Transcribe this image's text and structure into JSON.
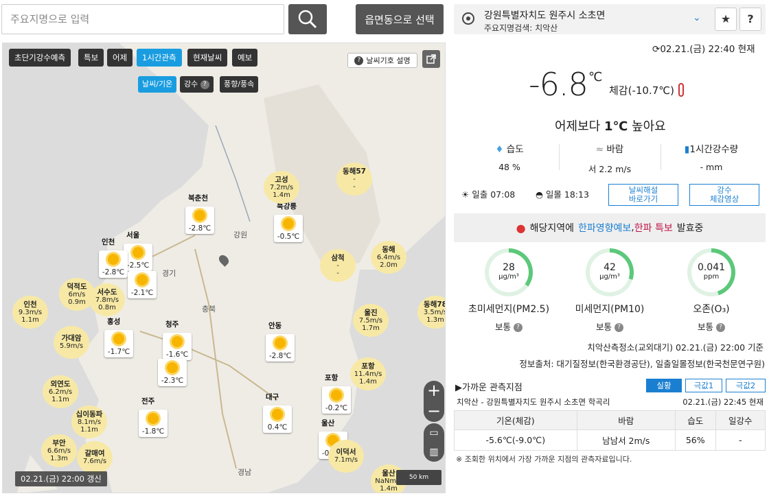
{
  "search": {
    "placeholder": "주요지명으로 입력",
    "region_button": "읍면동으로 선택"
  },
  "map": {
    "tabs": [
      "초단기강수예측",
      "특보",
      "어제",
      "1시간관측",
      "현재날씨",
      "예보"
    ],
    "active_tab": "1시간관측",
    "subtabs": [
      "날씨/기온",
      "강수",
      "풍향/풍속"
    ],
    "legend_button": "날씨기호 설명",
    "update_time": "02.21.(금) 22:00 갱신",
    "scale": "50 km",
    "region_labels": [
      "강원",
      "경기",
      "충북",
      "경남"
    ],
    "sun_stations": [
      {
        "name": "북춘천",
        "temp": "-2.8℃"
      },
      {
        "name": "북강릉",
        "temp": "-0.5℃"
      },
      {
        "name": "서울",
        "temp": "-2.5℃"
      },
      {
        "name": "인천",
        "temp": "-2.8℃"
      },
      {
        "name": "",
        "temp": "-2.1℃"
      },
      {
        "name": "홍성",
        "temp": "-1.7℃"
      },
      {
        "name": "청주",
        "temp": "-1.6℃"
      },
      {
        "name": "",
        "temp": "-2.3℃"
      },
      {
        "name": "안동",
        "temp": "-2.8℃"
      },
      {
        "name": "전주",
        "temp": "-1.8℃"
      },
      {
        "name": "대구",
        "temp": "0.4℃"
      },
      {
        "name": "포항",
        "temp": "-0.2℃"
      },
      {
        "name": "울산",
        "temp": "-0.3℃"
      }
    ],
    "wind_stations": [
      {
        "name": "고성",
        "speed": "7.2",
        "wave": "1.4"
      },
      {
        "name": "동해57",
        "speed": "-",
        "wave": "-"
      },
      {
        "name": "동해",
        "speed": "6.4",
        "wave": "2.0"
      },
      {
        "name": "삼척",
        "speed": "-",
        "wave": "-"
      },
      {
        "name": "인천",
        "speed": "9.3",
        "wave": "1.1"
      },
      {
        "name": "덕적도",
        "speed": "6",
        "wave": "0.9"
      },
      {
        "name": "서수도",
        "speed": "7.8",
        "wave": "0.8"
      },
      {
        "name": "가대암",
        "speed": "5.9",
        "wave": ""
      },
      {
        "name": "울진",
        "speed": "7.5",
        "wave": "1.7"
      },
      {
        "name": "동해78",
        "speed": "3.5",
        "wave": "1.3"
      },
      {
        "name": "포항",
        "speed": "11.4",
        "wave": "1.4"
      },
      {
        "name": "외연도",
        "speed": "6.2",
        "wave": "1.1"
      },
      {
        "name": "십이동파",
        "speed": "8.1",
        "wave": "1.1"
      },
      {
        "name": "부안",
        "speed": "6.6",
        "wave": "1.3"
      },
      {
        "name": "갈매여",
        "speed": "7.6",
        "wave": ""
      },
      {
        "name": "이덕서",
        "speed": "7.1",
        "wave": ""
      },
      {
        "name": "울산",
        "speed": "NaN",
        "wave": "1.4"
      }
    ]
  },
  "location": {
    "name": "강원특별자치도 원주시 소초면",
    "search": "주요지명검색: 치악산"
  },
  "obs_time": "02.21.(금) 22:40 현재",
  "current": {
    "temp": "-6.8",
    "unit": "℃",
    "feels": "체감(-10.7℃)",
    "compare_prefix": "어제보다",
    "compare_value": "1℃",
    "compare_suffix": "높아요"
  },
  "stats": [
    {
      "label": "습도",
      "value": "48 %"
    },
    {
      "label": "바람",
      "value": "서 2.2 m/s"
    },
    {
      "label": "1시간강수량",
      "value": "- mm"
    }
  ],
  "sun": {
    "sunrise_label": "일출",
    "sunrise": "07:08",
    "sunset_label": "일몰",
    "sunset": "18:13"
  },
  "links": {
    "weather_explain": "날씨해설\n바로가기",
    "precip_video": "강수\n체감영상"
  },
  "warning": {
    "prefix": "해당지역에",
    "impact": "한파영향예보",
    "sep": ",",
    "alert": "한파 특보",
    "suffix": "발효중"
  },
  "air": [
    {
      "value": "28",
      "unit": "μg/m³",
      "name": "초미세먼지(PM2.5)",
      "grade": "보통",
      "fraction": 0.35
    },
    {
      "value": "42",
      "unit": "μg/m³",
      "name": "미세먼지(PM10)",
      "grade": "보통",
      "fraction": 0.3
    },
    {
      "value": "0.041",
      "unit": "ppm",
      "name": "오존(O₃)",
      "grade": "보통",
      "fraction": 0.45
    }
  ],
  "air_station": "치악산측정소(교외대기) 02.21.(금) 22:00 기준",
  "air_source": "정보출처: 대기질정보(한국환경공단), 일출일몰정보(한국천문연구원)",
  "nearby": {
    "title": "▶가까운 관측지점",
    "tabs": [
      "실황",
      "극값1",
      "극값2"
    ],
    "location": "치악산 - 강원특별자치도 원주시 소초면 학곡리",
    "time": "02.21.(금) 22:45 현재",
    "headers": [
      "기온(체감)",
      "바람",
      "습도",
      "일강수"
    ],
    "row": [
      "-5.6℃(-9.0℃)",
      "남남서 2m/s",
      "56%",
      "-"
    ]
  },
  "footnote": "※ 조회한 위치에서 가장 가까운 지점의 관측자료입니다.",
  "colors": {
    "accent": "#1a7fd1",
    "active_tab": "#1a9de0",
    "air_ring": "#5cc87a",
    "alert": "#c0134a"
  }
}
